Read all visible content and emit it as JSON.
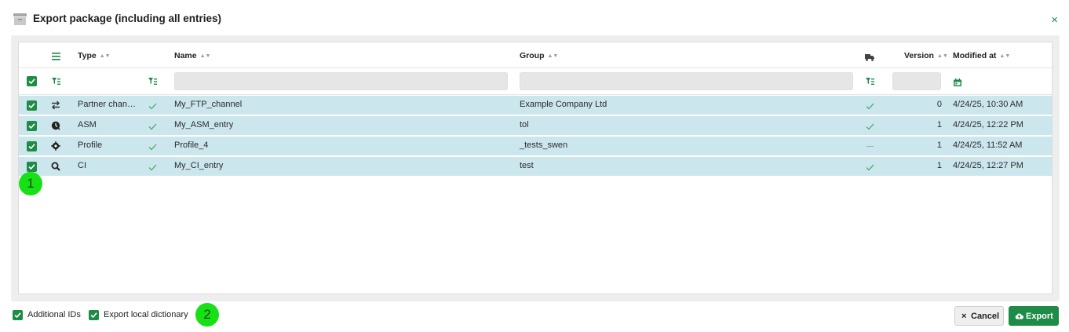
{
  "dialog": {
    "title": "Export package (including all entries)",
    "close_symbol": "×"
  },
  "icons": {
    "title": "archive-icon",
    "close": "close-icon",
    "column_menu": "menu-icon",
    "delivery_column": "truck-icon",
    "filter": "filter-icon",
    "calendar": "calendar-icon",
    "checkmark": "check-icon"
  },
  "colors": {
    "accent": "#1e8c46",
    "row_selected": "#cce6ee",
    "badge": "#17e017"
  },
  "table": {
    "headers": {
      "type": "Type",
      "name": "Name",
      "group": "Group",
      "version": "Version",
      "modified": "Modified at"
    },
    "sort_symbol": "▲▼",
    "rows": [
      {
        "type": "Partner chan…",
        "type_icon": "arrows-exchange-icon",
        "type_ok": true,
        "name": "My_FTP_channel",
        "group": "Example Company Ltd",
        "deliverable": "check",
        "version": "0",
        "modified": "4/24/25, 10:30 AM",
        "selected": true
      },
      {
        "type": "ASM",
        "type_icon": "asm-badge-icon",
        "type_ok": true,
        "name": "My_ASM_entry",
        "group": "tol",
        "deliverable": "check",
        "version": "1",
        "modified": "4/24/25, 12:22 PM",
        "selected": true
      },
      {
        "type": "Profile",
        "type_icon": "profile-gear-icon",
        "type_ok": true,
        "name": "Profile_4",
        "group": "_tests_swen",
        "deliverable": "dash",
        "version": "1",
        "modified": "4/24/25, 11:52 AM",
        "selected": true
      },
      {
        "type": "CI",
        "type_icon": "search-magnify-icon",
        "type_ok": true,
        "name": "My_CI_entry",
        "group": "test",
        "deliverable": "check",
        "version": "1",
        "modified": "4/24/25, 12:27 PM",
        "selected": true
      }
    ]
  },
  "annotations": {
    "badge_1": "1",
    "badge_2": "2"
  },
  "options": {
    "additional_ids": {
      "label": "Additional IDs",
      "checked": true
    },
    "export_local_dictionary": {
      "label": "Export local dictionary",
      "checked": true
    }
  },
  "buttons": {
    "cancel": {
      "symbol": "×",
      "label": "Cancel"
    },
    "export": {
      "label": "Export"
    }
  }
}
